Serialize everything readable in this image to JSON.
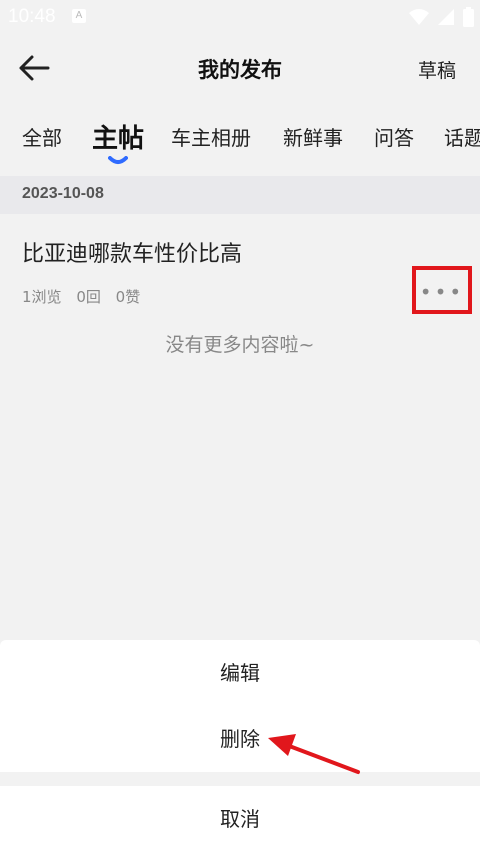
{
  "status_bar": {
    "time": "10:48",
    "notification_glyph": "A"
  },
  "header": {
    "title": "我的发布",
    "drafts_label": "草稿"
  },
  "tabs": [
    {
      "label": "全部"
    },
    {
      "label": "主帖"
    },
    {
      "label": "车主相册"
    },
    {
      "label": "新鲜事"
    },
    {
      "label": "问答"
    },
    {
      "label": "话题"
    }
  ],
  "active_tab": "主帖",
  "post": {
    "date": "2023-10-08",
    "title": "比亚迪哪款车性价比高",
    "views": "1浏览",
    "replies": "0回",
    "likes": "0赞",
    "more_glyph": "•••"
  },
  "no_more_text": "没有更多内容啦~",
  "action_sheet": {
    "edit_label": "编辑",
    "delete_label": "删除",
    "cancel_label": "取消"
  },
  "colors": {
    "accent": "#2f6bff",
    "highlight": "#e1171c"
  }
}
